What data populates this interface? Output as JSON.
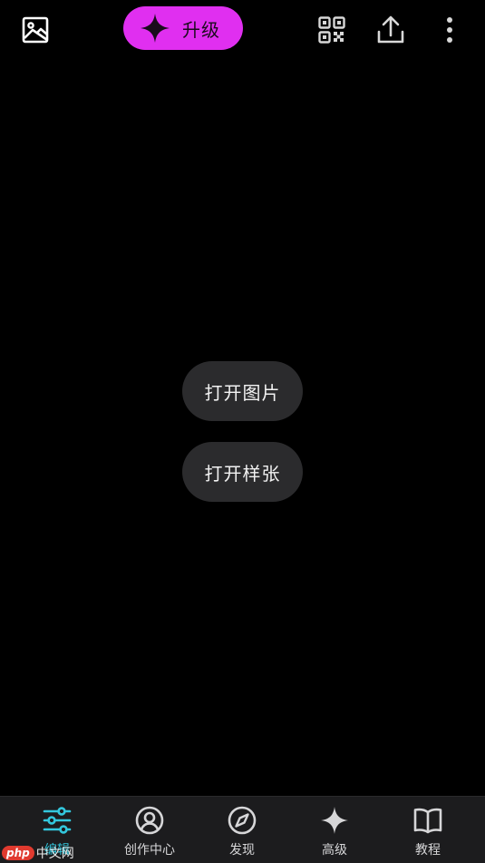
{
  "header": {
    "upgrade_label": "升级",
    "icons": {
      "gallery": "gallery-icon",
      "upgrade": "sparkle-icon",
      "qr": "qr-code-icon",
      "share": "share-upload-icon",
      "more": "more-vertical-icon"
    },
    "colors": {
      "upgrade_bg": "#e02ff0"
    }
  },
  "main": {
    "open_image_label": "打开图片",
    "open_sample_label": "打开样张"
  },
  "bottom_nav": {
    "active": "编辑",
    "items": [
      {
        "label": "编辑",
        "icon": "sliders-icon"
      },
      {
        "label": "创作中心",
        "icon": "user-circle-icon"
      },
      {
        "label": "发现",
        "icon": "compass-icon"
      },
      {
        "label": "高级",
        "icon": "sparkle-icon"
      },
      {
        "label": "教程",
        "icon": "book-icon"
      }
    ],
    "colors": {
      "active": "#33c7dd",
      "inactive": "#d6d6d8"
    }
  },
  "watermark": {
    "badge": "php",
    "text": "中文网"
  }
}
